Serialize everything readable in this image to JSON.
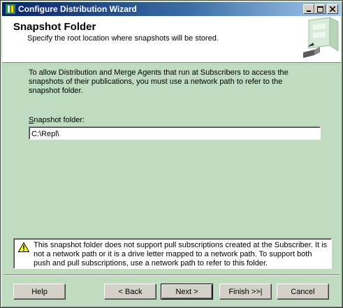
{
  "window": {
    "title": "Configure Distribution Wizard",
    "controls": [
      "_",
      "□",
      "×"
    ]
  },
  "header": {
    "title": "Snapshot Folder",
    "subtitle": "Specify the root location where snapshots will be stored."
  },
  "body": {
    "intro": "To allow Distribution and Merge Agents that run at Subscribers to access the snapshots of their publications, you must use a network path to refer to the snapshot folder.",
    "field_label_mnemonic": "S",
    "field_label_rest": "napshot folder:",
    "field_value": "C:\\Repl\\"
  },
  "warning": {
    "icon": "warning-icon",
    "text": "This snapshot folder does not support pull subscriptions created at the Subscriber. It is not a network path or it is a drive letter mapped to a network path. To support both push and pull subscriptions, use a network path to refer to this folder."
  },
  "buttons": {
    "help": "Help",
    "back": "< Back",
    "next": "Next >",
    "finish": "Finish >>|",
    "cancel": "Cancel"
  },
  "colors": {
    "dialog_bg": "#c0dcc0",
    "title_start": "#0a246a",
    "title_end": "#a6caf0"
  }
}
